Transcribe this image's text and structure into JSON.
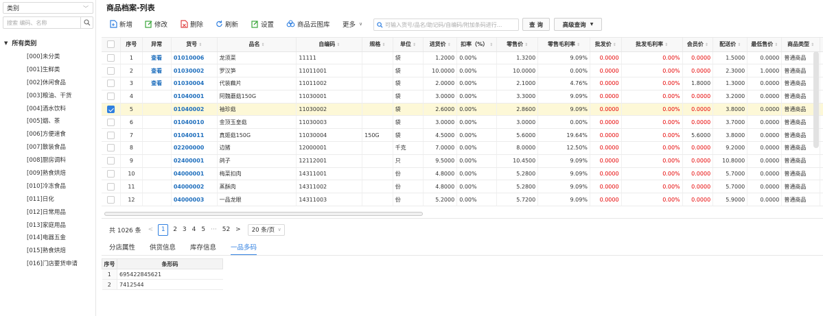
{
  "sidebar": {
    "category_select": "类别",
    "search_placeholder": "搜索 编码、名称",
    "root_label": "所有类别",
    "items": [
      "[000]未分类",
      "[001]生鲜类",
      "[002]休闲食品",
      "[003]粮油、干货",
      "[004]酒水饮料",
      "[005]烟、茶",
      "[006]方便速食",
      "[007]散装食品",
      "[008]厨房调料",
      "[009]熟食烘焙",
      "[010]冷冻食品",
      "[011]日化",
      "[012]日常用品",
      "[013]家庭用品",
      "[014]电器五金",
      "[015]熟食烘焙",
      "[016]门店要货申请"
    ]
  },
  "header": {
    "title": "商品档案-列表"
  },
  "toolbar": {
    "add": "新增",
    "edit": "修改",
    "delete": "删除",
    "refresh": "刷新",
    "settings": "设置",
    "cloud": "商品云图库",
    "more": "更多",
    "search_placeholder": "可输入货号/品名/助记码/自编码/附加条码进行...",
    "query": "查 询",
    "advanced": "高级查询"
  },
  "grid": {
    "columns": [
      "序号",
      "异常",
      "货号",
      "品名",
      "自编码",
      "规格",
      "单位",
      "进货价",
      "扣率（%）",
      "零售价",
      "零售毛利率",
      "批发价",
      "批发毛利率",
      "会员价",
      "配送价",
      "最低售价",
      "商品类型",
      "进"
    ],
    "rows": [
      {
        "no": "1",
        "abn": "查看",
        "code": "01010006",
        "name": "龙须菜",
        "self": "11111",
        "spec": "",
        "unit": "袋",
        "buy": "1.2000",
        "rate": "0.00%",
        "retail": "1.3200",
        "rgm": "9.09%",
        "whole": "0.0000",
        "wgm": "0.00%",
        "member": "0.0000",
        "dist": "1.5000",
        "min": "0.0000",
        "type": "普通商品"
      },
      {
        "no": "2",
        "abn": "查看",
        "code": "01030002",
        "name": "罗汉笋",
        "self": "11011001",
        "spec": "",
        "unit": "袋",
        "buy": "10.0000",
        "rate": "0.00%",
        "retail": "10.0000",
        "rgm": "0.00%",
        "whole": "0.0000",
        "wgm": "0.00%",
        "member": "0.0000",
        "dist": "2.3000",
        "min": "1.0000",
        "type": "普通商品"
      },
      {
        "no": "3",
        "abn": "查看",
        "code": "01030004",
        "name": "代装藕片",
        "self": "11011002",
        "spec": "",
        "unit": "袋",
        "buy": "2.0000",
        "rate": "0.00%",
        "retail": "2.1000",
        "rgm": "4.76%",
        "whole": "0.0000",
        "wgm": "0.00%",
        "member": "1.8000",
        "dist": "1.3000",
        "min": "0.0000",
        "type": "普通商品"
      },
      {
        "no": "4",
        "abn": "",
        "code": "01040001",
        "name": "阿魏蘑菇150G",
        "self": "11030001",
        "spec": "",
        "unit": "袋",
        "buy": "3.0000",
        "rate": "0.00%",
        "retail": "3.3000",
        "rgm": "9.09%",
        "whole": "0.0000",
        "wgm": "0.00%",
        "member": "0.0000",
        "dist": "3.2000",
        "min": "0.0000",
        "type": "普通商品"
      },
      {
        "no": "5",
        "abn": "",
        "code": "01040002",
        "name": "袖珍菇",
        "self": "11030002",
        "spec": "",
        "unit": "袋",
        "buy": "2.6000",
        "rate": "0.00%",
        "retail": "2.8600",
        "rgm": "9.09%",
        "whole": "0.0000",
        "wgm": "0.00%",
        "member": "0.0000",
        "dist": "3.8000",
        "min": "0.0000",
        "type": "普通商品"
      },
      {
        "no": "6",
        "abn": "",
        "code": "01040010",
        "name": "金顶玉皇菇",
        "self": "11030003",
        "spec": "",
        "unit": "袋",
        "buy": "3.0000",
        "rate": "0.00%",
        "retail": "3.0000",
        "rgm": "0.00%",
        "whole": "0.0000",
        "wgm": "0.00%",
        "member": "0.0000",
        "dist": "3.7000",
        "min": "0.0000",
        "type": "普通商品"
      },
      {
        "no": "7",
        "abn": "",
        "code": "01040011",
        "name": "真姬菇150G",
        "self": "11030004",
        "spec": "150G",
        "unit": "袋",
        "buy": "4.5000",
        "rate": "0.00%",
        "retail": "5.6000",
        "rgm": "19.64%",
        "whole": "0.0000",
        "wgm": "0.00%",
        "member": "5.6000",
        "dist": "3.8000",
        "min": "0.0000",
        "type": "普通商品"
      },
      {
        "no": "8",
        "abn": "",
        "code": "02200000",
        "name": "边猪",
        "self": "12000001",
        "spec": "",
        "unit": "千克",
        "buy": "7.0000",
        "rate": "0.00%",
        "retail": "8.0000",
        "rgm": "12.50%",
        "whole": "0.0000",
        "wgm": "0.00%",
        "member": "0.0000",
        "dist": "9.2000",
        "min": "0.0000",
        "type": "普通商品"
      },
      {
        "no": "9",
        "abn": "",
        "code": "02400001",
        "name": "鸽子",
        "self": "12112001",
        "spec": "",
        "unit": "只",
        "buy": "9.5000",
        "rate": "0.00%",
        "retail": "10.4500",
        "rgm": "9.09%",
        "whole": "0.0000",
        "wgm": "0.00%",
        "member": "0.0000",
        "dist": "10.8000",
        "min": "0.0000",
        "type": "普通商品"
      },
      {
        "no": "10",
        "abn": "",
        "code": "04000001",
        "name": "梅菜扣肉",
        "self": "14311001",
        "spec": "",
        "unit": "份",
        "buy": "4.8000",
        "rate": "0.00%",
        "retail": "5.2800",
        "rgm": "9.09%",
        "whole": "0.0000",
        "wgm": "0.00%",
        "member": "0.0000",
        "dist": "5.7000",
        "min": "0.0000",
        "type": "普通商品"
      },
      {
        "no": "11",
        "abn": "",
        "code": "04000002",
        "name": "蒸酥肉",
        "self": "14311002",
        "spec": "",
        "unit": "份",
        "buy": "4.8000",
        "rate": "0.00%",
        "retail": "5.2800",
        "rgm": "9.09%",
        "whole": "0.0000",
        "wgm": "0.00%",
        "member": "0.0000",
        "dist": "5.7000",
        "min": "0.0000",
        "type": "普通商品"
      },
      {
        "no": "12",
        "abn": "",
        "code": "04000003",
        "name": "一品龙眼",
        "self": "14311003",
        "spec": "",
        "unit": "份",
        "buy": "5.2000",
        "rate": "0.00%",
        "retail": "5.7200",
        "rgm": "9.09%",
        "whole": "0.0000",
        "wgm": "0.00%",
        "member": "0.0000",
        "dist": "5.9000",
        "min": "0.0000",
        "type": "普通商品"
      }
    ]
  },
  "pager": {
    "total": "共 1026 条",
    "pages": [
      "1",
      "2",
      "3",
      "4",
      "5"
    ],
    "ellipsis": "···",
    "last": "52",
    "page_size": "20 条/页"
  },
  "tabs": [
    "分店属性",
    "供货信息",
    "库存信息",
    "一品多码"
  ],
  "barcodes": {
    "headers": [
      "序号",
      "条形码"
    ],
    "rows": [
      {
        "no": "1",
        "code": "6954228456​21"
      },
      {
        "no": "2",
        "code": "7412544"
      }
    ]
  },
  "colors": {
    "accent": "#2f7fe0",
    "link": "#1f6fbd",
    "red": "#e60000",
    "selected_row": "#fdf8d7"
  }
}
